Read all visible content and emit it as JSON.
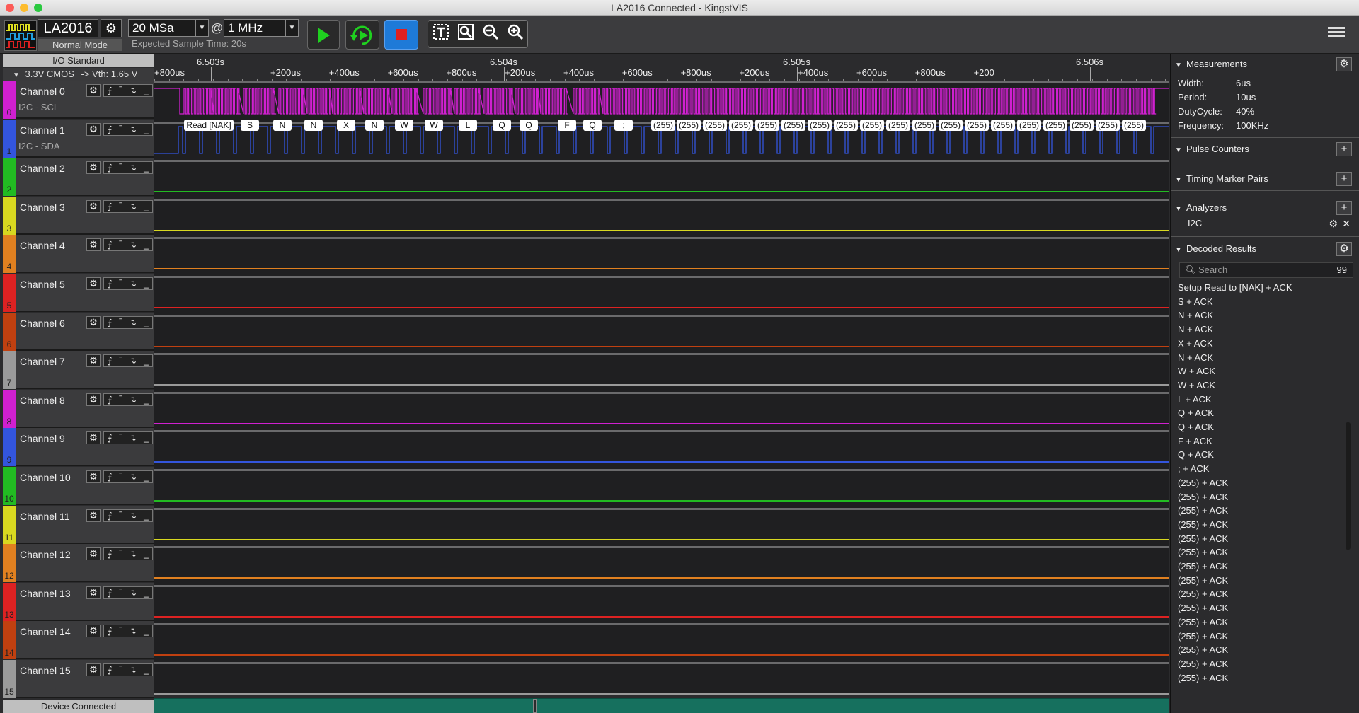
{
  "window": {
    "title": "LA2016 Connected - KingstVIS"
  },
  "toolbar": {
    "device_name": "LA2016",
    "mode": "Normal Mode",
    "sample_count": "20 MSa",
    "at_symbol": "@",
    "sample_rate": "1 MHz",
    "expected_time": "Expected Sample Time: 20s",
    "icons": [
      "play-icon",
      "loop-play-icon",
      "stop-icon",
      "text-tool-icon",
      "zoom-fit-icon",
      "zoom-out-icon",
      "zoom-in-icon",
      "menu-icon"
    ]
  },
  "left_panel": {
    "io_standard_title": "I/O Standard",
    "io_standard_value": "3.3V CMOS",
    "vth": "-> Vth: 1.65 V",
    "channels": [
      {
        "num": "0",
        "name": "Channel 0",
        "sub": "I2C - SCL",
        "color": "#d020d0"
      },
      {
        "num": "1",
        "name": "Channel 1",
        "sub": "I2C - SDA",
        "color": "#3355dd"
      },
      {
        "num": "2",
        "name": "Channel 2",
        "sub": "",
        "color": "#22bb22"
      },
      {
        "num": "3",
        "name": "Channel 3",
        "sub": "",
        "color": "#d8d820"
      },
      {
        "num": "4",
        "name": "Channel 4",
        "sub": "",
        "color": "#e08020"
      },
      {
        "num": "5",
        "name": "Channel 5",
        "sub": "",
        "color": "#dd2222"
      },
      {
        "num": "6",
        "name": "Channel 6",
        "sub": "",
        "color": "#c04010"
      },
      {
        "num": "7",
        "name": "Channel 7",
        "sub": "",
        "color": "#9a9a9a"
      },
      {
        "num": "8",
        "name": "Channel 8",
        "sub": "",
        "color": "#d020d0"
      },
      {
        "num": "9",
        "name": "Channel 9",
        "sub": "",
        "color": "#3355dd"
      },
      {
        "num": "10",
        "name": "Channel 10",
        "sub": "",
        "color": "#22bb22"
      },
      {
        "num": "11",
        "name": "Channel 11",
        "sub": "",
        "color": "#d8d820"
      },
      {
        "num": "12",
        "name": "Channel 12",
        "sub": "",
        "color": "#e08020"
      },
      {
        "num": "13",
        "name": "Channel 13",
        "sub": "",
        "color": "#dd2222"
      },
      {
        "num": "14",
        "name": "Channel 14",
        "sub": "",
        "color": "#c04010"
      },
      {
        "num": "15",
        "name": "Channel 15",
        "sub": "",
        "color": "#9a9a9a"
      }
    ],
    "status": "Device Connected"
  },
  "ruler": {
    "major": [
      "6.503s",
      "6.504s",
      "6.505s",
      "6.506s"
    ],
    "minor": [
      "+800us",
      "+200us",
      "+400us",
      "+600us",
      "+800us",
      "+200us",
      "+400us",
      "+600us",
      "+800us",
      "+200us",
      "+400us",
      "+600us",
      "+800us",
      "+200"
    ]
  },
  "decode_labels": [
    "Read [NAK]",
    "S",
    "N",
    "N",
    "X",
    "N",
    "W",
    "W",
    "L",
    "Q",
    "Q",
    "F",
    "Q",
    ";",
    "(255)",
    "(255)",
    "(255)",
    "(255)",
    "(255)",
    "(255)",
    "(255)",
    "(255)",
    "(255)",
    "(255)",
    "(255)",
    "(255)",
    "(255)",
    "(255)",
    "(255)",
    "(255)",
    "(255)",
    "(255)",
    "(255)"
  ],
  "right_panel": {
    "measurements": {
      "title": "Measurements",
      "width_label": "Width:",
      "width": "6us",
      "period_label": "Period:",
      "period": "10us",
      "duty_label": "DutyCycle:",
      "duty": "40%",
      "freq_label": "Frequency:",
      "freq": "100KHz"
    },
    "pulse_counters": "Pulse Counters",
    "timing_marker_pairs": "Timing Marker Pairs",
    "analyzers": {
      "title": "Analyzers",
      "item": "I2C"
    },
    "decoded": {
      "title": "Decoded Results",
      "search_placeholder": "Search",
      "count": "99",
      "results": [
        "Setup Read to [NAK] + ACK",
        "S + ACK",
        "N + ACK",
        "N + ACK",
        "X + ACK",
        "N + ACK",
        "W + ACK",
        "W + ACK",
        "L + ACK",
        "Q + ACK",
        "Q + ACK",
        "F + ACK",
        "Q + ACK",
        "; + ACK",
        "(255) + ACK",
        "(255) + ACK",
        "(255) + ACK",
        "(255) + ACK",
        "(255) + ACK",
        "(255) + ACK",
        "(255) + ACK",
        "(255) + ACK",
        "(255) + ACK",
        "(255) + ACK",
        "(255) + ACK",
        "(255) + ACK",
        "(255) + ACK",
        "(255) + ACK",
        "(255) + ACK"
      ]
    }
  }
}
